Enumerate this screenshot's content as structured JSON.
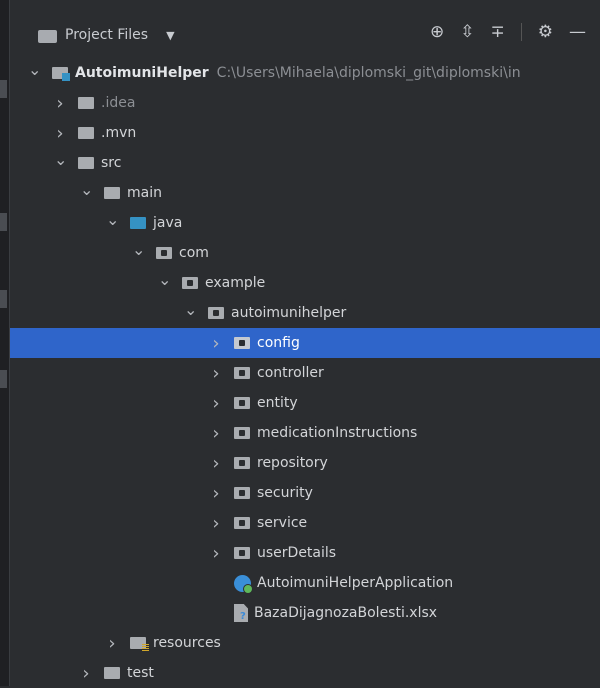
{
  "toolbar": {
    "title": "Project Files",
    "icons": [
      "locate-icon",
      "expand-all-icon",
      "collapse-all-icon",
      "settings-gear-icon",
      "minimize-icon"
    ]
  },
  "tree": [
    {
      "label": "AutoimuniHelper",
      "path": "C:\\Users\\Mihaela\\diplomski_git\\diplomski\\in",
      "level": 0,
      "expanded": true,
      "icon": "project-folder-icon"
    },
    {
      "label": ".idea",
      "level": 1,
      "expanded": false,
      "icon": "folder-icon",
      "dim": true
    },
    {
      "label": ".mvn",
      "level": 1,
      "expanded": false,
      "icon": "folder-icon"
    },
    {
      "label": "src",
      "level": 1,
      "expanded": true,
      "icon": "folder-icon"
    },
    {
      "label": "main",
      "level": 2,
      "expanded": true,
      "icon": "folder-icon"
    },
    {
      "label": "java",
      "level": 3,
      "expanded": true,
      "icon": "source-folder-icon"
    },
    {
      "label": "com",
      "level": 4,
      "expanded": true,
      "icon": "package-icon"
    },
    {
      "label": "example",
      "level": 5,
      "expanded": true,
      "icon": "package-icon"
    },
    {
      "label": "autoimunihelper",
      "level": 6,
      "expanded": true,
      "icon": "package-icon"
    },
    {
      "label": "config",
      "level": 7,
      "expanded": false,
      "icon": "package-icon",
      "selected": true
    },
    {
      "label": "controller",
      "level": 7,
      "expanded": false,
      "icon": "package-icon"
    },
    {
      "label": "entity",
      "level": 7,
      "expanded": false,
      "icon": "package-icon"
    },
    {
      "label": "medicationInstructions",
      "level": 7,
      "expanded": false,
      "icon": "package-icon"
    },
    {
      "label": "repository",
      "level": 7,
      "expanded": false,
      "icon": "package-icon"
    },
    {
      "label": "security",
      "level": 7,
      "expanded": false,
      "icon": "package-icon"
    },
    {
      "label": "service",
      "level": 7,
      "expanded": false,
      "icon": "package-icon"
    },
    {
      "label": "userDetails",
      "level": 7,
      "expanded": false,
      "icon": "package-icon"
    },
    {
      "label": "AutoimuniHelperApplication",
      "level": 7,
      "leaf": true,
      "icon": "spring-boot-app-icon"
    },
    {
      "label": "BazaDijagnozaBolesti.xlsx",
      "level": 7,
      "leaf": true,
      "icon": "xlsx-file-icon"
    },
    {
      "label": "resources",
      "level": 3,
      "expanded": false,
      "icon": "resources-folder-icon"
    },
    {
      "label": "test",
      "level": 2,
      "expanded": false,
      "icon": "folder-icon"
    }
  ]
}
